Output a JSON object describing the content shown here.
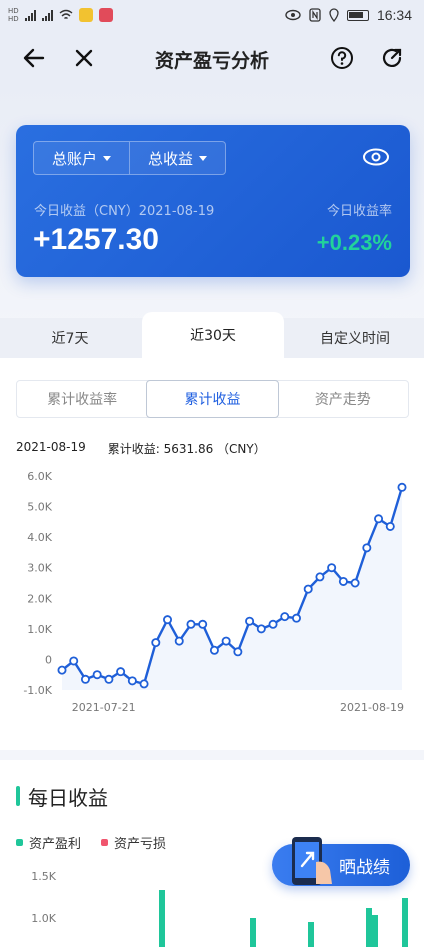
{
  "status_bar": {
    "left_tags": [
      "HD",
      "HD",
      "4G",
      "4G"
    ],
    "time": "16:34"
  },
  "nav": {
    "title": "资产盈亏分析",
    "icons": [
      "back-arrow-icon",
      "close-icon",
      "help-icon",
      "refresh-icon"
    ]
  },
  "summary": {
    "account_dropdown": "总账户",
    "metric_dropdown": "总收益",
    "today_label": "今日收益（CNY）2021-08-19",
    "today_value": "+1257.30",
    "rate_label": "今日收益率",
    "rate_value": "+0.23%",
    "colors": {
      "card": "#1f63dc",
      "positive": "#22d39a"
    }
  },
  "period_tabs": {
    "items": [
      "近7天",
      "近30天",
      "自定义时间"
    ],
    "active": "近30天"
  },
  "segments": {
    "items": [
      "累计收益率",
      "累计收益",
      "资产走势"
    ],
    "active": "累计收益"
  },
  "chart_info": {
    "date": "2021-08-19",
    "label": "累计收益: 5631.86 （CNY）"
  },
  "chart_data": {
    "type": "line",
    "y_ticks": [
      "6.0K",
      "5.0K",
      "4.0K",
      "3.0K",
      "2.0K",
      "1.0K",
      "0",
      "-1.0K"
    ],
    "x_ticks": [
      "2021-07-21",
      "2021-08-19"
    ],
    "ylim": [
      -1000,
      6000
    ],
    "grid": false,
    "series": [
      {
        "values": [
          -350,
          -50,
          -650,
          -500,
          -650,
          -400,
          -700,
          -800,
          550,
          1300,
          600,
          1150,
          1150,
          300,
          600,
          250,
          1250,
          1000,
          1150,
          1400,
          1350,
          2300,
          2700,
          3000,
          2550,
          2500,
          3650,
          4600,
          4350,
          5630
        ]
      }
    ],
    "color": "#1f5fd8"
  },
  "daily": {
    "title": "每日收益",
    "legend_profit": "资产盈利",
    "legend_loss": "资产亏损",
    "profit_color": "#1fc69a",
    "loss_color": "#f0556e",
    "share_label": "晒战绩",
    "y_ticks": [
      "1.5K",
      "1.0K"
    ]
  }
}
